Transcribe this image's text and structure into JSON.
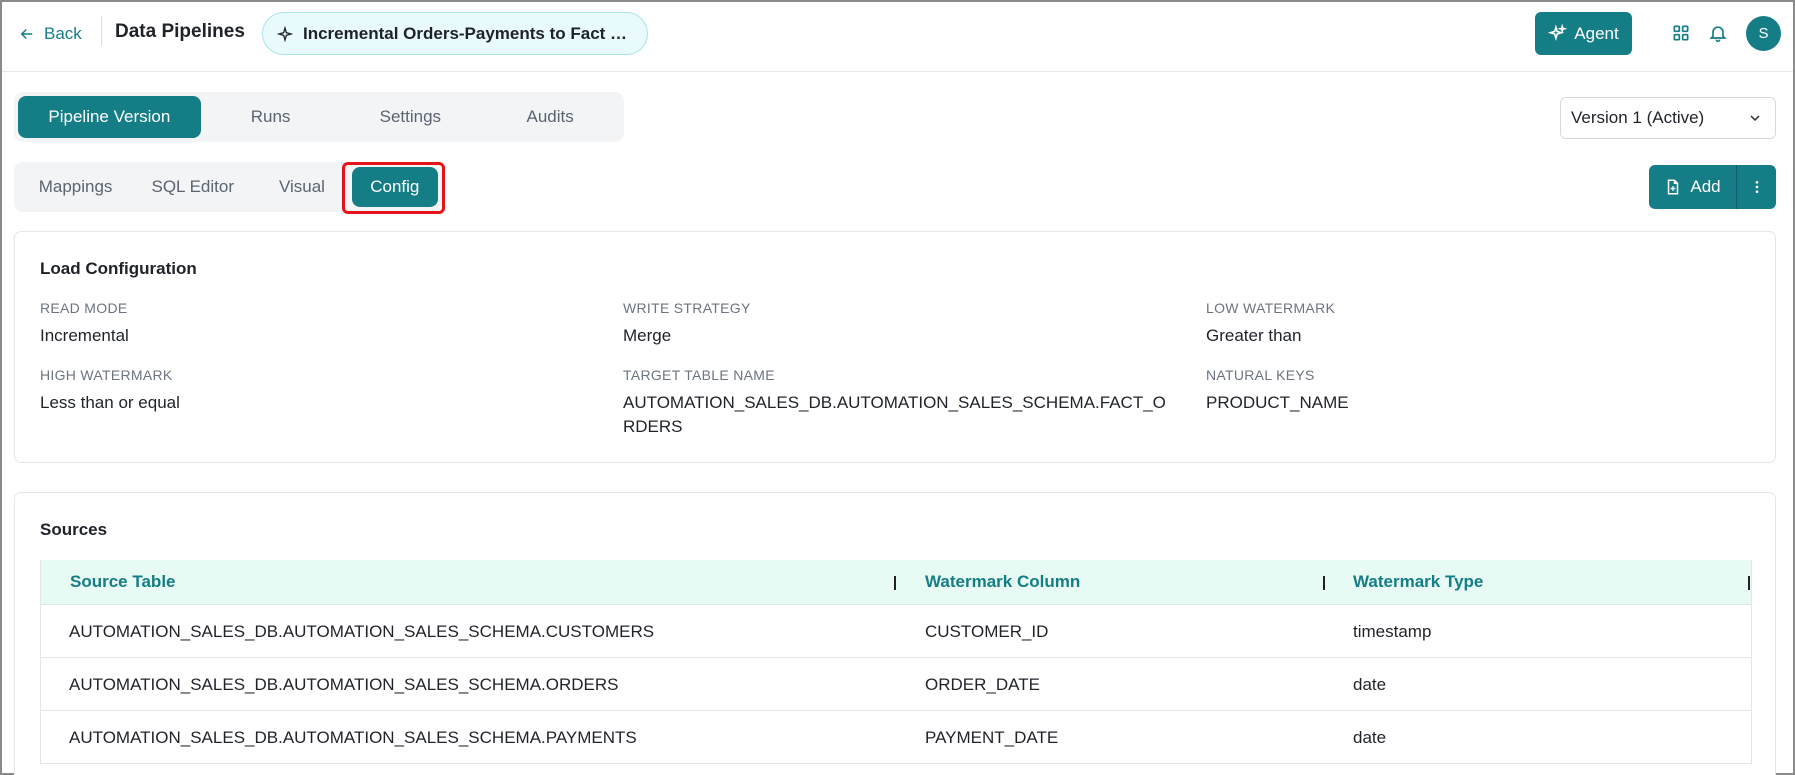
{
  "header": {
    "back_label": "Back",
    "title": "Data Pipelines",
    "pipeline_name": "Incremental Orders-Payments to Fact O...",
    "agent_label": "Agent",
    "avatar_initial": "S"
  },
  "primary_tabs": [
    {
      "label": "Pipeline Version",
      "active": true
    },
    {
      "label": "Runs",
      "active": false
    },
    {
      "label": "Settings",
      "active": false
    },
    {
      "label": "Audits",
      "active": false
    }
  ],
  "version_select": {
    "value": "Version 1 (Active)"
  },
  "secondary_tabs": [
    {
      "label": "Mappings",
      "active": false
    },
    {
      "label": "SQL Editor",
      "active": false
    },
    {
      "label": "Visual",
      "active": false
    },
    {
      "label": "Config",
      "active": true
    }
  ],
  "add_button": {
    "label": "Add"
  },
  "load_config": {
    "title": "Load Configuration",
    "fields": [
      {
        "label": "READ MODE",
        "value": "Incremental"
      },
      {
        "label": "WRITE STRATEGY",
        "value": "Merge"
      },
      {
        "label": "LOW WATERMARK",
        "value": "Greater than"
      },
      {
        "label": "HIGH WATERMARK",
        "value": "Less than or equal"
      },
      {
        "label": "TARGET TABLE NAME",
        "value": "AUTOMATION_SALES_DB.AUTOMATION_SALES_SCHEMA.FACT_ORDERS"
      },
      {
        "label": "NATURAL KEYS",
        "value": "PRODUCT_NAME"
      }
    ]
  },
  "sources": {
    "title": "Sources",
    "columns": [
      "Source Table",
      "Watermark Column",
      "Watermark Type"
    ],
    "rows": [
      [
        "AUTOMATION_SALES_DB.AUTOMATION_SALES_SCHEMA.CUSTOMERS",
        "CUSTOMER_ID",
        "timestamp"
      ],
      [
        "AUTOMATION_SALES_DB.AUTOMATION_SALES_SCHEMA.ORDERS",
        "ORDER_DATE",
        "date"
      ],
      [
        "AUTOMATION_SALES_DB.AUTOMATION_SALES_SCHEMA.PAYMENTS",
        "PAYMENT_DATE",
        "date"
      ]
    ]
  },
  "colors": {
    "accent": "#157d86",
    "highlight": "#e5141a",
    "table_header_bg": "#e7faf3"
  }
}
